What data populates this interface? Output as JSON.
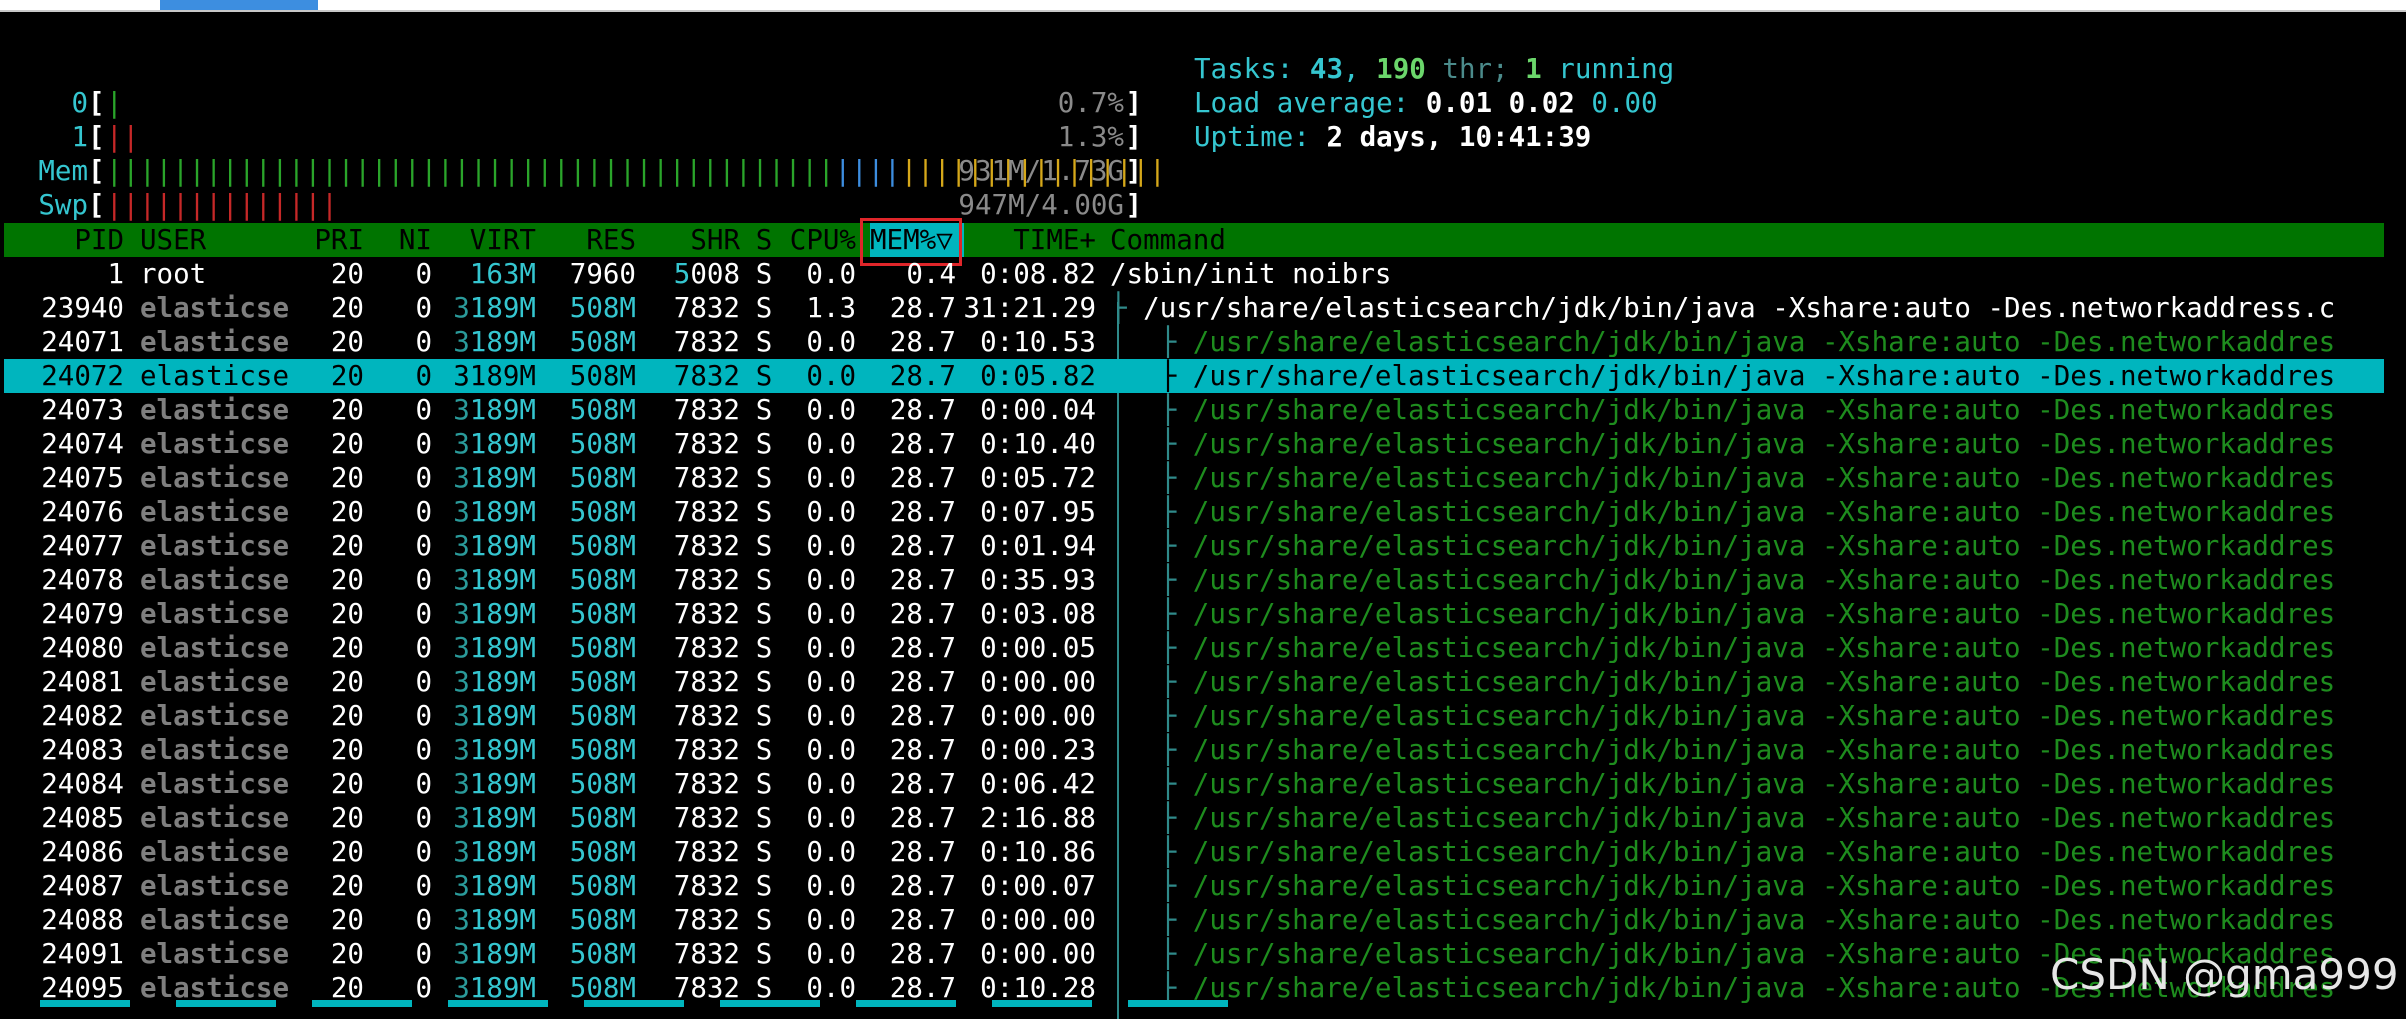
{
  "meters": {
    "cpu0": {
      "label": "0",
      "value": "0.7%",
      "bar": "|"
    },
    "cpu1": {
      "label": "1",
      "value": "1.3%",
      "bar": "||"
    },
    "mem": {
      "label": "Mem",
      "value": "931M/1.73G"
    },
    "swp": {
      "label": "Swp",
      "value": "947M/4.00G",
      "bar": "||||||||||||||"
    }
  },
  "info": {
    "tasks_label": "Tasks: ",
    "tasks": "43",
    "sep": ", ",
    "threads": "190",
    "thr_label": " thr; ",
    "running": "1",
    "running_label": " running",
    "load_label": "Load average: ",
    "load1": "0.01",
    "load5": "0.02",
    "load15": "0.00",
    "uptime_label": "Uptime: ",
    "uptime": "2 days, 10:41:39"
  },
  "columns": {
    "pid": "PID",
    "user": "USER",
    "pri": "PRI",
    "ni": "NI",
    "virt": "VIRT",
    "res": "RES",
    "shr": "SHR",
    "s": "S",
    "cpu": "CPU%",
    "mem": "MEM%▽",
    "time": "TIME+",
    "command": "Command"
  },
  "processes": [
    {
      "pid": "1",
      "user": "root",
      "pri": "20",
      "ni": "0",
      "virt": "163M",
      "res": "7960",
      "shr": "5008",
      "s": "S",
      "cpu": "0.0",
      "mem": "0.4",
      "time": "0:08.82",
      "tree": "",
      "command": "/sbin/init noibrs"
    },
    {
      "pid": "23940",
      "user": "elasticse",
      "pri": "20",
      "ni": "0",
      "virt": "3189M",
      "res": "508M",
      "shr": "7832",
      "s": "S",
      "cpu": "1.3",
      "mem": "28.7",
      "time": "31:21.29",
      "tree": "├ ",
      "command": "/usr/share/elasticsearch/jdk/bin/java -Xshare:auto -Des.networkaddress.c"
    },
    {
      "pid": "24071",
      "user": "elasticse",
      "pri": "20",
      "ni": "0",
      "virt": "3189M",
      "res": "508M",
      "shr": "7832",
      "s": "S",
      "cpu": "0.0",
      "mem": "28.7",
      "time": "0:10.53",
      "tree": "   ├ ",
      "command": "/usr/share/elasticsearch/jdk/bin/java -Xshare:auto -Des.networkaddres"
    },
    {
      "pid": "24072",
      "user": "elasticse",
      "pri": "20",
      "ni": "0",
      "virt": "3189M",
      "res": "508M",
      "shr": "7832",
      "s": "S",
      "cpu": "0.0",
      "mem": "28.7",
      "time": "0:05.82",
      "tree": "   ├ ",
      "command": "/usr/share/elasticsearch/jdk/bin/java -Xshare:auto -Des.networkaddres",
      "selected": true
    },
    {
      "pid": "24073",
      "user": "elasticse",
      "pri": "20",
      "ni": "0",
      "virt": "3189M",
      "res": "508M",
      "shr": "7832",
      "s": "S",
      "cpu": "0.0",
      "mem": "28.7",
      "time": "0:00.04",
      "tree": "   ├ ",
      "command": "/usr/share/elasticsearch/jdk/bin/java -Xshare:auto -Des.networkaddres"
    },
    {
      "pid": "24074",
      "user": "elasticse",
      "pri": "20",
      "ni": "0",
      "virt": "3189M",
      "res": "508M",
      "shr": "7832",
      "s": "S",
      "cpu": "0.0",
      "mem": "28.7",
      "time": "0:10.40",
      "tree": "   ├ ",
      "command": "/usr/share/elasticsearch/jdk/bin/java -Xshare:auto -Des.networkaddres"
    },
    {
      "pid": "24075",
      "user": "elasticse",
      "pri": "20",
      "ni": "0",
      "virt": "3189M",
      "res": "508M",
      "shr": "7832",
      "s": "S",
      "cpu": "0.0",
      "mem": "28.7",
      "time": "0:05.72",
      "tree": "   ├ ",
      "command": "/usr/share/elasticsearch/jdk/bin/java -Xshare:auto -Des.networkaddres"
    },
    {
      "pid": "24076",
      "user": "elasticse",
      "pri": "20",
      "ni": "0",
      "virt": "3189M",
      "res": "508M",
      "shr": "7832",
      "s": "S",
      "cpu": "0.0",
      "mem": "28.7",
      "time": "0:07.95",
      "tree": "   ├ ",
      "command": "/usr/share/elasticsearch/jdk/bin/java -Xshare:auto -Des.networkaddres"
    },
    {
      "pid": "24077",
      "user": "elasticse",
      "pri": "20",
      "ni": "0",
      "virt": "3189M",
      "res": "508M",
      "shr": "7832",
      "s": "S",
      "cpu": "0.0",
      "mem": "28.7",
      "time": "0:01.94",
      "tree": "   ├ ",
      "command": "/usr/share/elasticsearch/jdk/bin/java -Xshare:auto -Des.networkaddres"
    },
    {
      "pid": "24078",
      "user": "elasticse",
      "pri": "20",
      "ni": "0",
      "virt": "3189M",
      "res": "508M",
      "shr": "7832",
      "s": "S",
      "cpu": "0.0",
      "mem": "28.7",
      "time": "0:35.93",
      "tree": "   ├ ",
      "command": "/usr/share/elasticsearch/jdk/bin/java -Xshare:auto -Des.networkaddres"
    },
    {
      "pid": "24079",
      "user": "elasticse",
      "pri": "20",
      "ni": "0",
      "virt": "3189M",
      "res": "508M",
      "shr": "7832",
      "s": "S",
      "cpu": "0.0",
      "mem": "28.7",
      "time": "0:03.08",
      "tree": "   ├ ",
      "command": "/usr/share/elasticsearch/jdk/bin/java -Xshare:auto -Des.networkaddres"
    },
    {
      "pid": "24080",
      "user": "elasticse",
      "pri": "20",
      "ni": "0",
      "virt": "3189M",
      "res": "508M",
      "shr": "7832",
      "s": "S",
      "cpu": "0.0",
      "mem": "28.7",
      "time": "0:00.05",
      "tree": "   ├ ",
      "command": "/usr/share/elasticsearch/jdk/bin/java -Xshare:auto -Des.networkaddres"
    },
    {
      "pid": "24081",
      "user": "elasticse",
      "pri": "20",
      "ni": "0",
      "virt": "3189M",
      "res": "508M",
      "shr": "7832",
      "s": "S",
      "cpu": "0.0",
      "mem": "28.7",
      "time": "0:00.00",
      "tree": "   ├ ",
      "command": "/usr/share/elasticsearch/jdk/bin/java -Xshare:auto -Des.networkaddres"
    },
    {
      "pid": "24082",
      "user": "elasticse",
      "pri": "20",
      "ni": "0",
      "virt": "3189M",
      "res": "508M",
      "shr": "7832",
      "s": "S",
      "cpu": "0.0",
      "mem": "28.7",
      "time": "0:00.00",
      "tree": "   ├ ",
      "command": "/usr/share/elasticsearch/jdk/bin/java -Xshare:auto -Des.networkaddres"
    },
    {
      "pid": "24083",
      "user": "elasticse",
      "pri": "20",
      "ni": "0",
      "virt": "3189M",
      "res": "508M",
      "shr": "7832",
      "s": "S",
      "cpu": "0.0",
      "mem": "28.7",
      "time": "0:00.23",
      "tree": "   ├ ",
      "command": "/usr/share/elasticsearch/jdk/bin/java -Xshare:auto -Des.networkaddres"
    },
    {
      "pid": "24084",
      "user": "elasticse",
      "pri": "20",
      "ni": "0",
      "virt": "3189M",
      "res": "508M",
      "shr": "7832",
      "s": "S",
      "cpu": "0.0",
      "mem": "28.7",
      "time": "0:06.42",
      "tree": "   ├ ",
      "command": "/usr/share/elasticsearch/jdk/bin/java -Xshare:auto -Des.networkaddres"
    },
    {
      "pid": "24085",
      "user": "elasticse",
      "pri": "20",
      "ni": "0",
      "virt": "3189M",
      "res": "508M",
      "shr": "7832",
      "s": "S",
      "cpu": "0.0",
      "mem": "28.7",
      "time": "2:16.88",
      "tree": "   ├ ",
      "command": "/usr/share/elasticsearch/jdk/bin/java -Xshare:auto -Des.networkaddres"
    },
    {
      "pid": "24086",
      "user": "elasticse",
      "pri": "20",
      "ni": "0",
      "virt": "3189M",
      "res": "508M",
      "shr": "7832",
      "s": "S",
      "cpu": "0.0",
      "mem": "28.7",
      "time": "0:10.86",
      "tree": "   ├ ",
      "command": "/usr/share/elasticsearch/jdk/bin/java -Xshare:auto -Des.networkaddres"
    },
    {
      "pid": "24087",
      "user": "elasticse",
      "pri": "20",
      "ni": "0",
      "virt": "3189M",
      "res": "508M",
      "shr": "7832",
      "s": "S",
      "cpu": "0.0",
      "mem": "28.7",
      "time": "0:00.07",
      "tree": "   ├ ",
      "command": "/usr/share/elasticsearch/jdk/bin/java -Xshare:auto -Des.networkaddres"
    },
    {
      "pid": "24088",
      "user": "elasticse",
      "pri": "20",
      "ni": "0",
      "virt": "3189M",
      "res": "508M",
      "shr": "7832",
      "s": "S",
      "cpu": "0.0",
      "mem": "28.7",
      "time": "0:00.00",
      "tree": "   ├ ",
      "command": "/usr/share/elasticsearch/jdk/bin/java -Xshare:auto -Des.networkaddres"
    },
    {
      "pid": "24091",
      "user": "elasticse",
      "pri": "20",
      "ni": "0",
      "virt": "3189M",
      "res": "508M",
      "shr": "7832",
      "s": "S",
      "cpu": "0.0",
      "mem": "28.7",
      "time": "0:00.00",
      "tree": "   ├ ",
      "command": "/usr/share/elasticsearch/jdk/bin/java -Xshare:auto -Des.networkaddres"
    },
    {
      "pid": "24095",
      "user": "elasticse",
      "pri": "20",
      "ni": "0",
      "virt": "3189M",
      "res": "508M",
      "shr": "7832",
      "s": "S",
      "cpu": "0.0",
      "mem": "28.7",
      "time": "0:10.28",
      "tree": "   ├ ",
      "command": "/usr/share/elasticsearch/jdk/bin/java -Xshare:auto -Des.networkaddres"
    }
  ],
  "watermark": "CSDN @gma999",
  "colors": {
    "header_bg": "#007400",
    "selected_bg": "#00b5be",
    "sort_highlight_border": "#e0262a",
    "meter_label": "#35c6d0"
  }
}
